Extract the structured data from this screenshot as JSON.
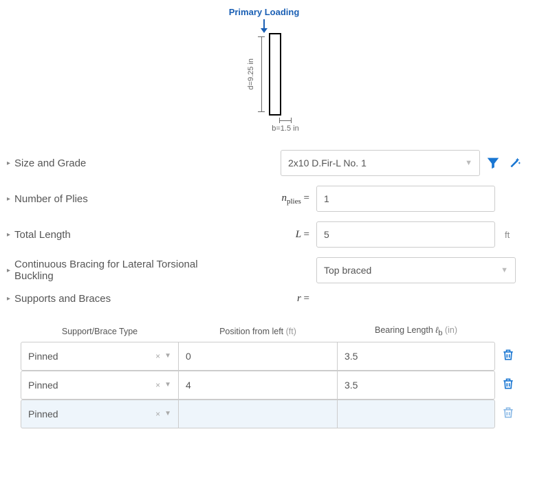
{
  "diagram": {
    "loading_label": "Primary Loading",
    "depth_label": "d=9.25 in",
    "breadth_label": "b=1.5 in"
  },
  "fields": {
    "size_grade": {
      "label": "Size and Grade",
      "value": "2x10 D.Fir-L No. 1"
    },
    "plies": {
      "label": "Number of Plies",
      "symbol_base": "n",
      "symbol_sub": "plies",
      "value": "1"
    },
    "length": {
      "label": "Total Length",
      "symbol": "L",
      "value": "5",
      "unit": "ft"
    },
    "bracing": {
      "label": "Continuous Bracing for Lateral Torsional Buckling",
      "value": "Top braced"
    },
    "supports": {
      "label": "Supports and Braces",
      "symbol": "r"
    }
  },
  "table": {
    "headers": {
      "type": "Support/Brace Type",
      "position": "Position from left",
      "position_unit": "(ft)",
      "bearing": "Bearing Length ",
      "bearing_sym": "ℓ",
      "bearing_sub": "b",
      "bearing_unit": " (in)"
    },
    "rows": [
      {
        "type": "Pinned",
        "position": "0",
        "bearing": "3.5",
        "empty": false
      },
      {
        "type": "Pinned",
        "position": "4",
        "bearing": "3.5",
        "empty": false
      },
      {
        "type": "Pinned",
        "position": "",
        "bearing": "",
        "empty": true
      }
    ]
  }
}
